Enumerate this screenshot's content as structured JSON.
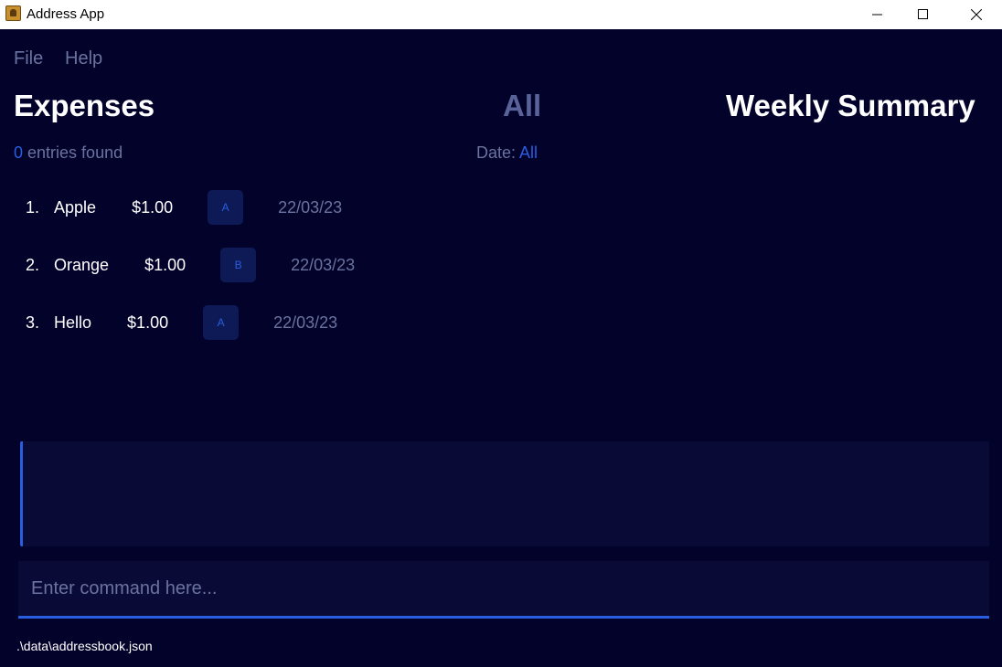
{
  "window": {
    "title": "Address App",
    "icons": {
      "app": "address-book-icon",
      "minimize": "minimize-icon",
      "maximize": "maximize-icon",
      "close": "close-icon"
    }
  },
  "menu": {
    "items": [
      {
        "label": "File"
      },
      {
        "label": "Help"
      }
    ]
  },
  "panels": {
    "expenses_title": "Expenses",
    "filter_title": "All",
    "summary_title": "Weekly Summary"
  },
  "expenses": {
    "count": "0",
    "count_suffix": "entries found",
    "date_label": "Date:",
    "date_value": "All",
    "entries": [
      {
        "index": "1.",
        "name": "Apple",
        "price": "$1.00",
        "category": "A",
        "date": "22/03/23"
      },
      {
        "index": "2.",
        "name": "Orange",
        "price": "$1.00",
        "category": "B",
        "date": "22/03/23"
      },
      {
        "index": "3.",
        "name": "Hello",
        "price": "$1.00",
        "category": "A",
        "date": "22/03/23"
      }
    ]
  },
  "result": {
    "text": ""
  },
  "command": {
    "value": "",
    "placeholder": "Enter command here..."
  },
  "status": {
    "path": ".\\data\\addressbook.json"
  },
  "colors": {
    "background": "#02022a",
    "accent": "#2a5de0",
    "muted": "#6a739f",
    "surface": "#0a0a36",
    "chip": "#0e1a55"
  }
}
